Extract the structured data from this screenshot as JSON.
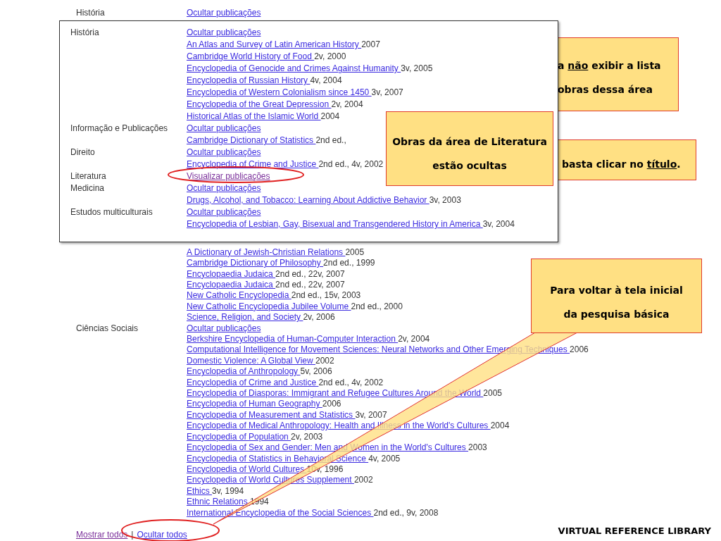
{
  "background_page": {
    "top_row": {
      "category": "História",
      "toggle": {
        "label": "Ocultar publicações",
        "visited": false
      }
    },
    "categories": [
      {
        "publications": [
          {
            "title": "A Dictionary of Jewish-Christian Relations ",
            "details": "2005"
          },
          {
            "title": "Cambridge Dictionary of Philosophy ",
            "details": "2nd ed., 1999"
          },
          {
            "title": "Encyclopaedia Judaica ",
            "details": "2nd ed., 22v, 2007"
          },
          {
            "title": "Encyclopaedia Judaica ",
            "details": "2nd ed., 22v, 2007"
          },
          {
            "title": "New Catholic Encyclopedia ",
            "details": "2nd ed., 15v, 2003"
          },
          {
            "title": "New Catholic Encyclopedia Jubilee Volume ",
            "details": "2nd ed., 2000"
          },
          {
            "title": "Science, Religion, and Society ",
            "details": "2v, 2006"
          }
        ]
      },
      {
        "name": "Ciências Sociais",
        "toggle": {
          "label": "Ocultar publicações",
          "visited": false
        },
        "publications": [
          {
            "title": "Berkshire Encyclopedia of Human-Computer Interaction ",
            "details": "2v, 2004"
          },
          {
            "title": "Computational Intelligence for Movement Sciences: Neural Networks and Other Emerging Techniques ",
            "details": "2006"
          },
          {
            "title": "Domestic Violence: A Global View ",
            "details": "2002"
          },
          {
            "title": "Encyclopedia of Anthropology ",
            "details": "5v, 2006"
          },
          {
            "title": "Encyclopedia of Crime and Justice ",
            "details": "2nd ed., 4v, 2002"
          },
          {
            "title": "Encyclopedia of Diasporas: Immigrant and Refugee Cultures Around the World ",
            "details": "2005"
          },
          {
            "title": "Encyclopedia of Human Geography ",
            "details": "2006"
          },
          {
            "title": "Encyclopedia of Measurement and Statistics ",
            "details": "3v, 2007"
          },
          {
            "title": "Encyclopedia of Medical Anthropology: Health and Illness in the World's Cultures ",
            "details": "2004"
          },
          {
            "title": "Encyclopedia of Population ",
            "details": "2v, 2003"
          },
          {
            "title": "Encyclopedia of Sex and Gender: Men and Women in the World's Cultures ",
            "details": "2003"
          },
          {
            "title": "Encyclopedia of Statistics in Behavioral Science ",
            "details": "4v, 2005"
          },
          {
            "title": "Encyclopedia of World Cultures ",
            "details": "10v, 1996"
          },
          {
            "title": "Encyclopedia of World Cultures Supplement ",
            "details": "2002"
          },
          {
            "title": "Ethics ",
            "details": "3v, 1994"
          },
          {
            "title": "Ethnic Relations ",
            "details": "1994"
          },
          {
            "title": "International Encyclopedia of the Social Sciences ",
            "details": "2nd ed., 9v, 2008"
          }
        ]
      }
    ],
    "footer_links": [
      {
        "label": "Mostrar todos",
        "visited": true
      },
      {
        "label": "Ocultar todos",
        "visited": false
      }
    ],
    "footer_separator": "|"
  },
  "inset_panel": {
    "categories": [
      {
        "name": "História",
        "toggle": {
          "label": "Ocultar publicações",
          "visited": false
        },
        "publications": [
          {
            "title": "An Atlas and Survey of Latin American History ",
            "details": "2007"
          },
          {
            "title": "Cambridge World History of Food ",
            "details": "2v, 2000"
          },
          {
            "title": "Encyclopedia of Genocide and Crimes Against Humanity ",
            "details": "3v, 2005"
          },
          {
            "title": "Encyclopedia of Russian History ",
            "details": "4v, 2004"
          },
          {
            "title": "Encyclopedia of Western Colonialism since 1450 ",
            "details": "3v, 2007"
          },
          {
            "title": "Encyclopedia of the Great Depression ",
            "details": "2v, 2004"
          },
          {
            "title": "Historical Atlas of the Islamic World ",
            "details": "2004"
          }
        ]
      },
      {
        "name": "Informação e Publicações",
        "toggle": {
          "label": "Ocultar publicações",
          "visited": false
        },
        "publications": [
          {
            "title": "Cambridge Dictionary of Statistics ",
            "details": "2nd ed.,"
          }
        ]
      },
      {
        "name": "Direito",
        "toggle": {
          "label": "Ocultar publicações",
          "visited": false
        },
        "publications": [
          {
            "title": "Encyclopedia of Crime and Justice ",
            "details": "2nd ed., 4v, 2002"
          }
        ]
      },
      {
        "name": "Literatura",
        "toggle": {
          "label": "Visualizar publicações",
          "visited": true
        }
      },
      {
        "name": "Medicina",
        "toggle": {
          "label": "Ocultar publicações",
          "visited": false
        },
        "publications": [
          {
            "title": "Drugs, Alcohol, and Tobacco: Learning About Addictive Behavior ",
            "details": "3v, 2003"
          }
        ]
      },
      {
        "name": "Estudos multiculturais",
        "toggle": {
          "label": "Ocultar publicações",
          "visited": false
        },
        "publications": [
          {
            "title": "Encyclopedia of Lesbian, Gay, Bisexual and Transgendered History in America ",
            "details": "3v, 2004"
          }
        ]
      }
    ]
  },
  "callouts": [
    {
      "kind": "behind",
      "lines": [
        [
          {
            "text": "a ",
            "underline": false
          },
          {
            "text": "não",
            "underline": true
          },
          {
            "text": " exibir a lista",
            "underline": false
          }
        ],
        [
          {
            "text": "obras dessa área",
            "underline": false
          }
        ]
      ]
    },
    {
      "kind": "front",
      "lines": [
        [
          {
            "text": "Obras da área de Literatura",
            "underline": false
          }
        ],
        [
          {
            "text": "estão ocultas",
            "underline": false
          }
        ]
      ]
    },
    {
      "kind": "behind",
      "lines": [
        [
          {
            "text": "basta clicar no ",
            "underline": false
          },
          {
            "text": "título",
            "underline": true
          },
          {
            "text": ".",
            "underline": false
          }
        ]
      ]
    },
    {
      "kind": "pointer",
      "lines": [
        [
          {
            "text": "Para voltar à tela inicial",
            "underline": false
          }
        ],
        [
          {
            "text": "da pesquisa básica",
            "underline": false
          }
        ]
      ]
    }
  ],
  "footer_title": "VIRTUAL REFERENCE LIBRARY"
}
